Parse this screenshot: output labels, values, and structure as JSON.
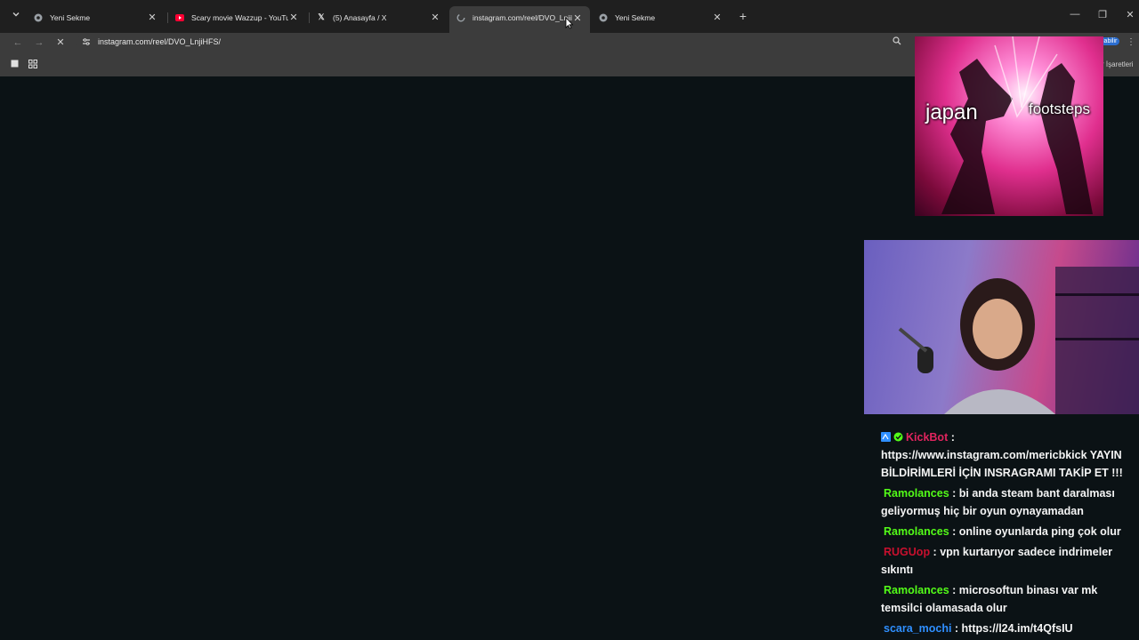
{
  "browser": {
    "tabs": [
      {
        "title": "Yeni Sekme",
        "favicon": "chrome-icon",
        "active": false
      },
      {
        "title": "Scary movie Wazzup - YouTube",
        "favicon": "youtube-icon",
        "active": false
      },
      {
        "title": "(5) Anasayfa / X",
        "favicon": "x-icon",
        "active": false
      },
      {
        "title": "instagram.com/reel/DVO_LnjiH",
        "favicon": "instagram-icon",
        "active": true
      },
      {
        "title": "Yeni Sekme",
        "favicon": "chrome-icon",
        "active": false
      }
    ],
    "address_bar": {
      "url": "instagram.com/reel/DVO_LnjiHFS/"
    },
    "profile_text": "labilir",
    "bookmarks_label": "r İşaretleri"
  },
  "overlay": {
    "left_label": "japan",
    "right_label": "footsteps"
  },
  "chat": {
    "messages": [
      {
        "user": "KickBot",
        "separator": " :",
        "text": "https://www.instagram.com/mericbkick YAYIN BİLDİRİMLERİ İÇİN INSRAGRAMI TAKİP ET !!!",
        "color": "#e0245e"
      },
      {
        "user": "Ramolances",
        "separator": " :",
        "text": " bi anda steam bant daralması geliyormuş hiç bir oyun oynayamadan",
        "color": "#53fc18"
      },
      {
        "user": "Ramolances",
        "separator": " :",
        "text": " online oyunlarda ping çok olur",
        "color": "#53fc18"
      },
      {
        "user": "RUGUop",
        "separator": " :",
        "text": " vpn kurtarıyor sadece indrimeler sıkıntı",
        "color": "#c8102e"
      },
      {
        "user": "Ramolances",
        "separator": " :",
        "text": " microsoftun binası var mk temsilci olamasada olur",
        "color": "#53fc18"
      },
      {
        "user": "scara_mochi",
        "separator": " :",
        "text": " https://l24.im/t4QfsIU",
        "color": "#2f8fff"
      }
    ]
  }
}
